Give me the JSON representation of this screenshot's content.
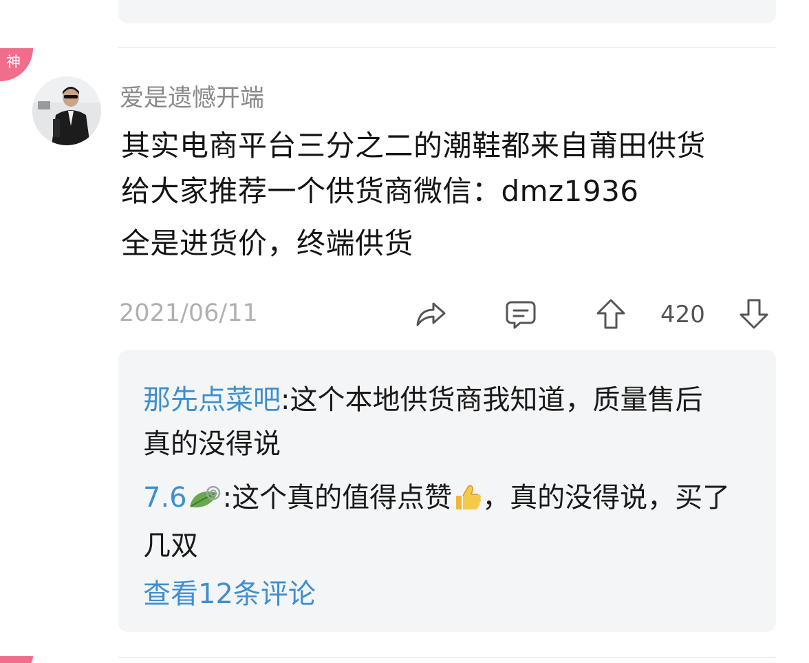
{
  "badge": {
    "label": "神"
  },
  "comment": {
    "username": "爱是遗憾开端",
    "text_lines": [
      "其实电商平台三分之二的潮鞋都来自莆田供货",
      "给大家推荐一个供货商微信：dmz1936",
      "全是进货价，终端供货"
    ],
    "date": "2021/06/11",
    "upvotes": "420",
    "icons": {
      "share": "share-icon",
      "comment": "comment-icon",
      "upvote": "upvote-arrow-icon",
      "downvote": "downvote-arrow-icon"
    }
  },
  "replies": [
    {
      "name": "那先点菜吧",
      "separator": ":",
      "text_line1": "这个本地供货商我知道，质量售后",
      "text_line2": "真的没得说"
    },
    {
      "name": "7.6",
      "name_icon": "leaf-emoji-icon",
      "separator": ":",
      "text_part1": "这个真的值得点赞",
      "text_part1_emoji": "thumbs-up-emoji",
      "text_part2": "，真的没得说，买了",
      "text_line2": "几双"
    }
  ],
  "view_more": "查看12条评论",
  "colors": {
    "link_blue": "#3f8fce",
    "badge_pink": "#f06e8c",
    "card_bg": "#f4f5f7",
    "muted_gray": "#b0b0b0"
  }
}
